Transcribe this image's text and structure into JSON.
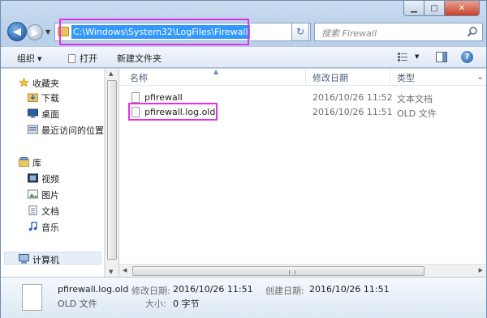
{
  "window": {
    "caption": {
      "minimize": "▁",
      "maximize": "□",
      "close": "✕"
    }
  },
  "navigation": {
    "back": "◀",
    "forward": "▶",
    "address_path": "C:\\Windows\\System32\\LogFiles\\Firewall",
    "refresh": "↻",
    "search_placeholder": "搜索 Firewall",
    "address_icon": "folder-icon",
    "search_icon": "search-icon"
  },
  "toolbar": {
    "organize": "组织",
    "open": "打开",
    "new_folder": "新建文件夹",
    "help": "?"
  },
  "sidebar": {
    "groups": [
      {
        "label": "收藏夹",
        "icon": "star-icon",
        "children": [
          {
            "label": "下载",
            "icon": "download-folder-icon"
          },
          {
            "label": "桌面",
            "icon": "desktop-icon"
          },
          {
            "label": "最近访问的位置",
            "icon": "recent-places-icon"
          }
        ]
      },
      {
        "label": "库",
        "icon": "library-icon",
        "children": [
          {
            "label": "视频",
            "icon": "video-icon"
          },
          {
            "label": "图片",
            "icon": "pictures-icon"
          },
          {
            "label": "文档",
            "icon": "documents-icon"
          },
          {
            "label": "音乐",
            "icon": "music-icon"
          }
        ]
      },
      {
        "label": "计算机",
        "icon": "computer-icon",
        "children": []
      }
    ]
  },
  "file_list": {
    "columns": [
      "名称",
      "修改日期",
      "类型"
    ],
    "rows": [
      {
        "name": "pfirewall",
        "modified": "2016/10/26 11:52",
        "type": "文本文档"
      },
      {
        "name": "pfirewall.log.old",
        "modified": "2016/10/26 11:51",
        "type": "OLD 文件"
      }
    ]
  },
  "details": {
    "name": "pfirewall.log.old",
    "type": "OLD 文件",
    "modified_label": "修改日期:",
    "modified_value": "2016/10/26 11:51",
    "created_label": "创建日期:",
    "created_value": "2016/10/26 11:51",
    "size_label": "大小:",
    "size_value": "0 字节"
  },
  "colors": {
    "highlight_annotation": "#e42ee8",
    "address_selection": "#3399ff"
  }
}
